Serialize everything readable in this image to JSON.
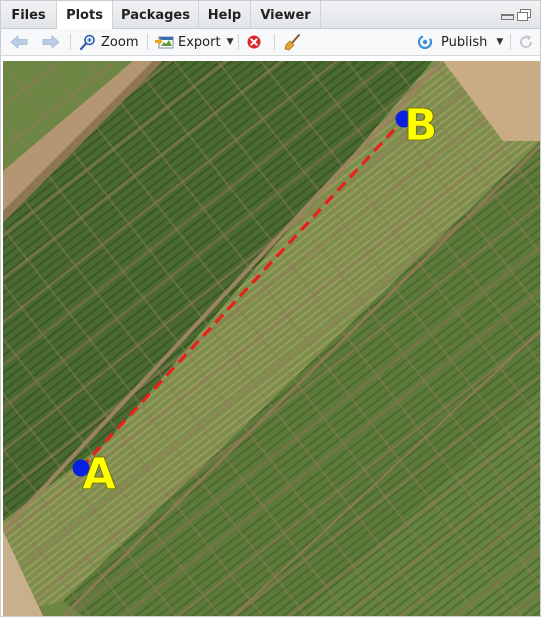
{
  "tabs": [
    {
      "label": "Files"
    },
    {
      "label": "Plots",
      "active": true
    },
    {
      "label": "Packages"
    },
    {
      "label": "Help"
    },
    {
      "label": "Viewer"
    }
  ],
  "toolbar": {
    "zoom_label": "Zoom",
    "export_label": "Export",
    "publish_label": "Publish"
  },
  "icons": [
    "back-arrow-icon",
    "forward-arrow-icon",
    "zoom-icon",
    "export-icon",
    "remove-plot-icon",
    "clear-broom-icon",
    "publish-icon",
    "refresh-icon",
    "minimize-icon",
    "maximize-icon"
  ],
  "plot": {
    "point_a_label": "A",
    "point_b_label": "B",
    "marker_color": "#0b1fe0",
    "label_color": "#ffff00",
    "path_color": "#e8201a"
  }
}
